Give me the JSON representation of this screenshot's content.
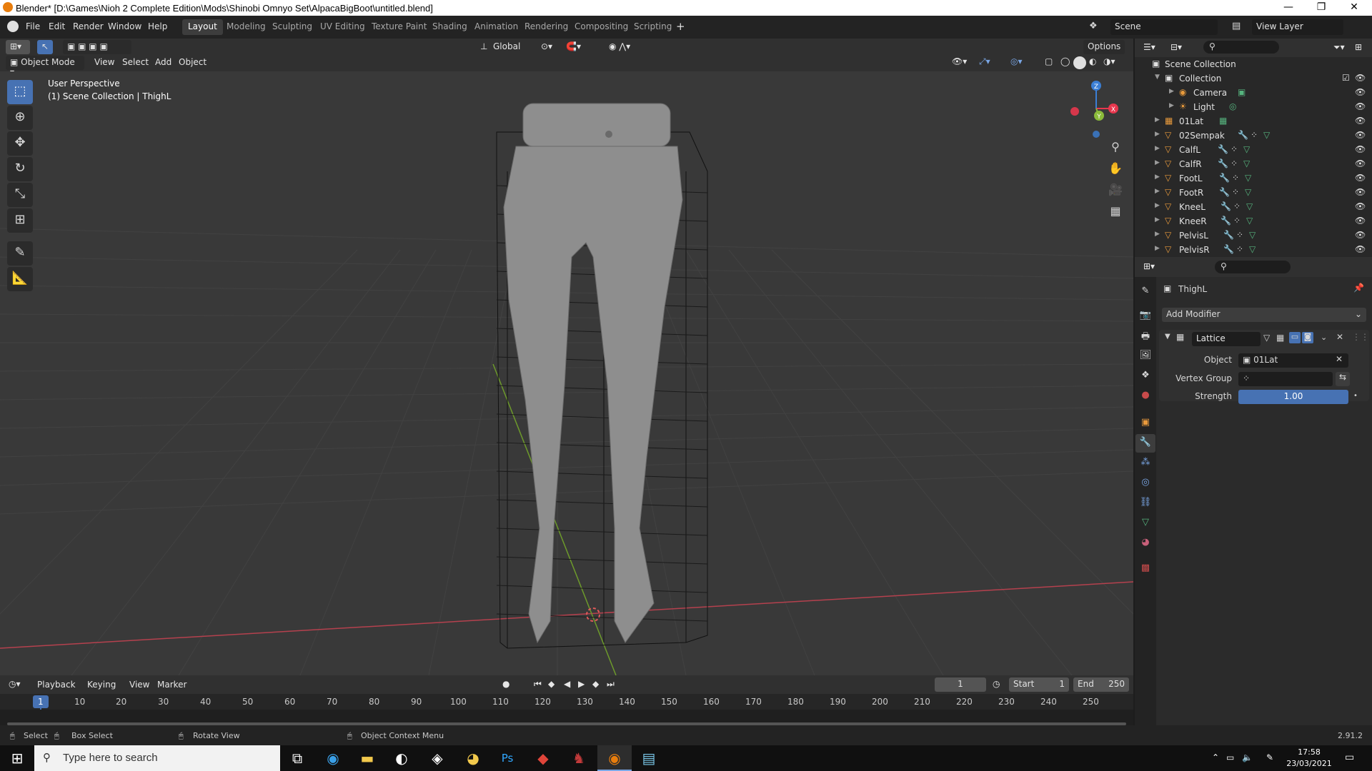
{
  "window": {
    "title": "Blender* [D:\\Games\\Nioh 2 Complete Edition\\Mods\\Shinobi Omnyo Set\\AlpacaBigBoot\\untitled.blend]"
  },
  "menu": {
    "file": "File",
    "edit": "Edit",
    "render": "Render",
    "window": "Window",
    "help": "Help"
  },
  "workspaces": [
    {
      "label": "Layout",
      "active": true
    },
    {
      "label": "Modeling"
    },
    {
      "label": "Sculpting"
    },
    {
      "label": "UV Editing"
    },
    {
      "label": "Texture Paint"
    },
    {
      "label": "Shading"
    },
    {
      "label": "Animation"
    },
    {
      "label": "Rendering"
    },
    {
      "label": "Compositing"
    },
    {
      "label": "Scripting"
    }
  ],
  "top_right": {
    "scene": "Scene",
    "view_layer": "View Layer"
  },
  "viewport_header": {
    "transform_orientation": "Global",
    "options": "Options",
    "mode": "Object Mode",
    "view": "View",
    "select": "Select",
    "add": "Add",
    "object": "Object"
  },
  "viewport": {
    "perspective": "User Perspective",
    "collection_info": "(1) Scene Collection | ThighL",
    "gizmo_axes": {
      "x": "X",
      "y": "Y",
      "z": "Z"
    }
  },
  "outliner": {
    "root": "Scene Collection",
    "items": [
      {
        "name": "Collection",
        "type": "collection"
      },
      {
        "name": "Camera",
        "type": "camera"
      },
      {
        "name": "Light",
        "type": "light"
      },
      {
        "name": "01Lat",
        "type": "lattice"
      },
      {
        "name": "02Sempak",
        "type": "mesh"
      },
      {
        "name": "CalfL",
        "type": "mesh"
      },
      {
        "name": "CalfR",
        "type": "mesh"
      },
      {
        "name": "FootL",
        "type": "mesh"
      },
      {
        "name": "FootR",
        "type": "mesh"
      },
      {
        "name": "KneeL",
        "type": "mesh"
      },
      {
        "name": "KneeR",
        "type": "mesh"
      },
      {
        "name": "PelvisL",
        "type": "mesh"
      },
      {
        "name": "PelvisR",
        "type": "mesh"
      }
    ]
  },
  "properties": {
    "object_name": "ThighL",
    "add_modifier": "Add Modifier",
    "modifier": {
      "name": "Lattice",
      "object_label": "Object",
      "object_value": "01Lat",
      "vertex_group_label": "Vertex Group",
      "strength_label": "Strength",
      "strength_value": "1.00"
    }
  },
  "timeline": {
    "playback": "Playback",
    "keying": "Keying",
    "view": "View",
    "marker": "Marker",
    "current_frame": "1",
    "start_label": "Start",
    "start": "1",
    "end_label": "End",
    "end": "250",
    "ticks": [
      "1",
      "10",
      "20",
      "30",
      "40",
      "50",
      "60",
      "70",
      "80",
      "90",
      "100",
      "110",
      "120",
      "130",
      "140",
      "150",
      "160",
      "170",
      "180",
      "190",
      "200",
      "210",
      "220",
      "230",
      "240",
      "250"
    ]
  },
  "status_bar": {
    "select": "Select",
    "box_select": "Box Select",
    "rotate_view": "Rotate View",
    "context_menu": "Object Context Menu",
    "version": "2.91.2"
  },
  "taskbar": {
    "search_placeholder": "Type here to search",
    "time": "17:58",
    "date": "23/03/2021"
  },
  "colors": {
    "accent": "#4772b3",
    "x_axis": "#e8374e",
    "y_axis": "#8bbb3a",
    "z_axis": "#3b7fd6"
  }
}
